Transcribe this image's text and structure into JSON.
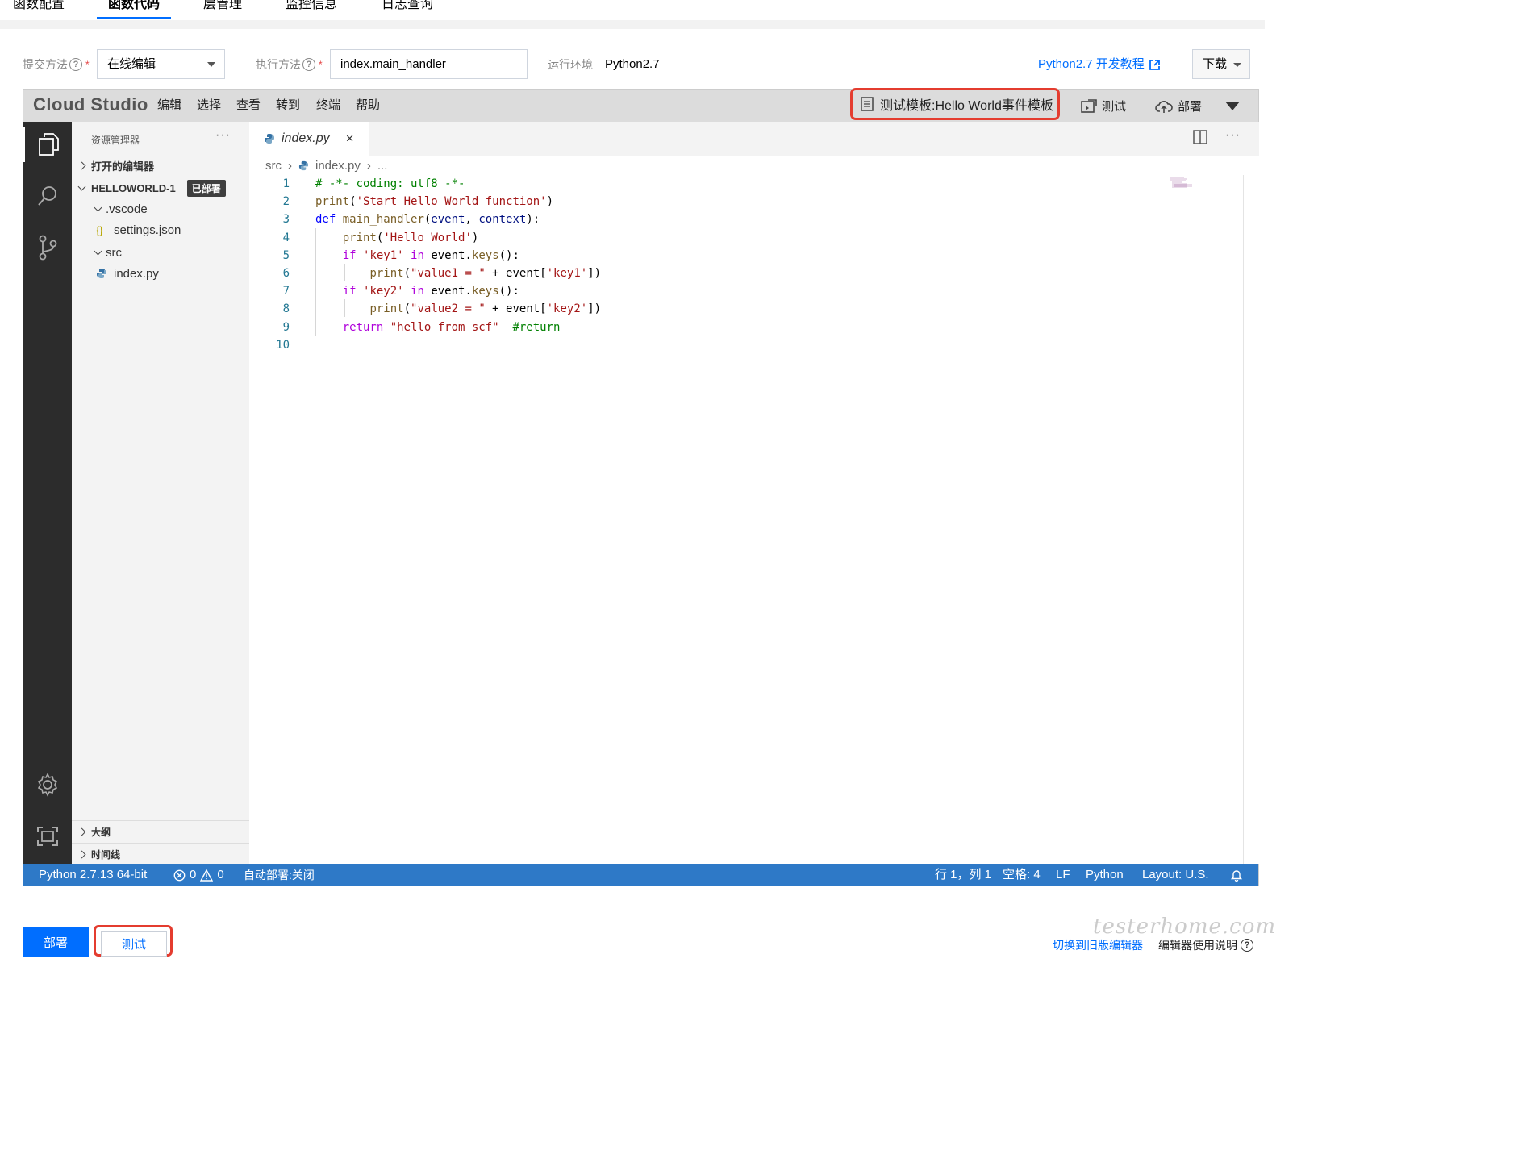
{
  "top_tabs": [
    {
      "label": "函数配置",
      "active": false
    },
    {
      "label": "函数代码",
      "active": true
    },
    {
      "label": "层管理",
      "active": false
    },
    {
      "label": "监控信息",
      "active": false
    },
    {
      "label": "日志查询",
      "active": false
    }
  ],
  "form": {
    "submit_method_label": "提交方法",
    "submit_method_value": "在线编辑",
    "exec_method_label": "执行方法",
    "exec_method_value": "index.main_handler",
    "runtime_label": "运行环境",
    "runtime_value": "Python2.7",
    "doc_link": "Python2.7 开发教程",
    "download_label": "下载"
  },
  "ide": {
    "logo": "Cloud Studio",
    "menu": [
      "编辑",
      "选择",
      "查看",
      "转到",
      "终端",
      "帮助"
    ],
    "test_template": "测试模板:Hello World事件模板",
    "test_label": "测试",
    "deploy_label": "部署",
    "explorer": {
      "title": "资源管理器",
      "open_editors": "打开的编辑器",
      "project": "HELLOWORLD-1",
      "deployed_badge": "已部署",
      "tree": [
        ".vscode",
        "settings.json",
        "src",
        "index.py"
      ],
      "outline": "大纲",
      "timeline": "时间线"
    },
    "tab": {
      "filename": "index.py",
      "close": "×"
    },
    "breadcrumb": {
      "folder": "src",
      "file": "index.py",
      "more": "..."
    },
    "code_lines": [
      {
        "n": "1",
        "text": "# -*- coding: utf8 -*-"
      },
      {
        "n": "2",
        "text": "print('Start Hello World function')"
      },
      {
        "n": "3",
        "text": "def main_handler(event, context):"
      },
      {
        "n": "4",
        "text": "    print('Hello World')"
      },
      {
        "n": "5",
        "text": "    if 'key1' in event.keys():"
      },
      {
        "n": "6",
        "text": "        print(\"value1 = \" + event['key1'])"
      },
      {
        "n": "7",
        "text": "    if 'key2' in event.keys():"
      },
      {
        "n": "8",
        "text": "        print(\"value2 = \" + event['key2'])"
      },
      {
        "n": "9",
        "text": "    return \"hello from scf\"  #return"
      },
      {
        "n": "10",
        "text": ""
      }
    ],
    "status": {
      "python": "Python 2.7.13 64-bit",
      "errors": "0",
      "warnings": "0",
      "auto_deploy": "自动部署:关闭",
      "position": "行 1，列 1",
      "spaces": "空格: 4",
      "eol": "LF",
      "language": "Python",
      "layout": "Layout: U.S."
    }
  },
  "bottom": {
    "deploy_button": "部署",
    "test_button": "测试",
    "switch_link": "切换到旧版编辑器",
    "help_link": "编辑器使用说明",
    "watermark": "testerhome.com"
  },
  "colors": {
    "accent": "#006eff",
    "statusbar": "#2e79c7",
    "highlight_border": "#e43c2f",
    "keyword": "#af00db",
    "string": "#a31515",
    "comment": "#008000",
    "param": "#001080",
    "def_kw": "#0000ff",
    "line_number": "#237893"
  }
}
